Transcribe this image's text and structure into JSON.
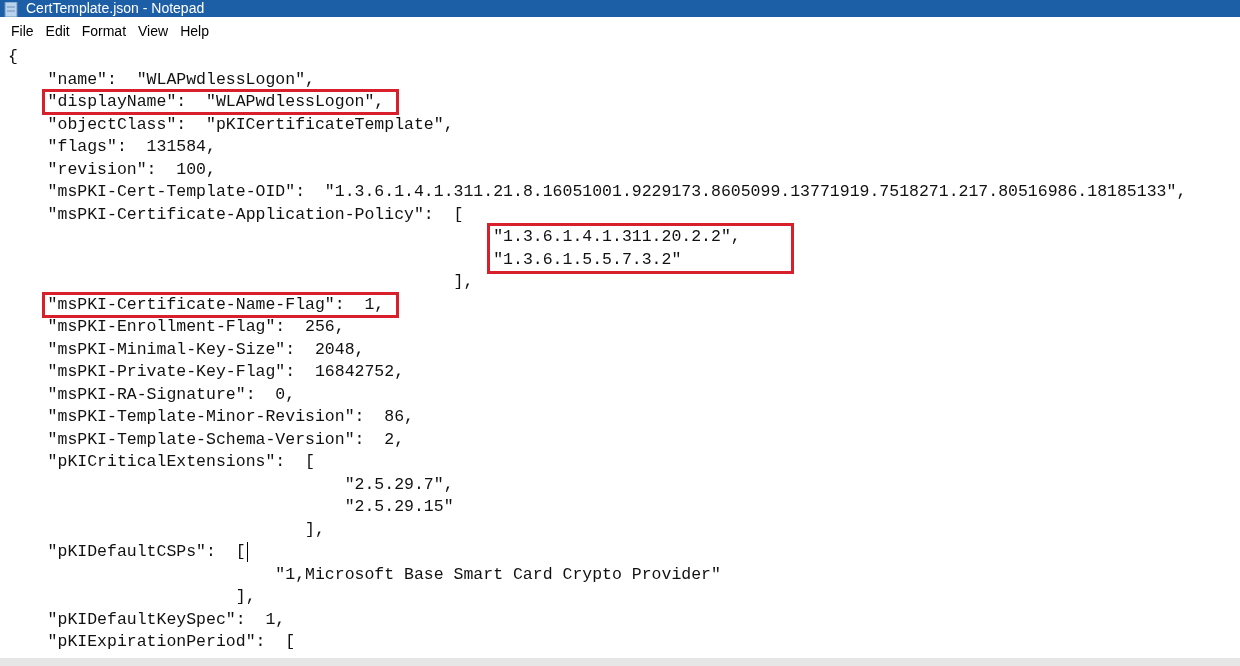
{
  "window": {
    "title": "CertTemplate.json - Notepad"
  },
  "menu": [
    "File",
    "Edit",
    "Format",
    "View",
    "Help"
  ],
  "document": {
    "open_brace": "{",
    "entries": [
      {
        "kind": "scalar",
        "key": "\"name\":",
        "value": "\"WLAPwdlessLogon\",",
        "highlighted": false,
        "text_cursor": false
      },
      {
        "kind": "scalar",
        "key": "\"displayName\":",
        "value": "\"WLAPwdlessLogon\",",
        "highlighted": true,
        "text_cursor": false
      },
      {
        "kind": "scalar",
        "key": "\"objectClass\":",
        "value": "\"pKICertificateTemplate\",",
        "highlighted": false,
        "text_cursor": false
      },
      {
        "kind": "scalar",
        "key": "\"flags\":",
        "value": "131584,",
        "highlighted": false,
        "text_cursor": false
      },
      {
        "kind": "scalar",
        "key": "\"revision\":",
        "value": "100,",
        "highlighted": false,
        "text_cursor": false
      },
      {
        "kind": "scalar",
        "key": "\"msPKI-Cert-Template-OID\":",
        "value": "\"1.3.6.1.4.1.311.21.8.16051001.9229173.8605099.13771919.7518271.217.80516986.18185133\",",
        "highlighted": false,
        "text_cursor": false
      },
      {
        "kind": "array",
        "key": "\"msPKI-Certificate-Application-Policy\":",
        "open": "[",
        "items": [
          "\"1.3.6.1.4.1.311.20.2.2\",",
          "\"1.3.6.1.5.5.7.3.2\""
        ],
        "close": "],",
        "highlighted": false,
        "items_highlighted": true,
        "text_cursor": false
      },
      {
        "kind": "scalar",
        "key": "\"msPKI-Certificate-Name-Flag\":",
        "value": "1,",
        "highlighted": true,
        "text_cursor": false
      },
      {
        "kind": "scalar",
        "key": "\"msPKI-Enrollment-Flag\":",
        "value": "256,",
        "highlighted": false,
        "text_cursor": false
      },
      {
        "kind": "scalar",
        "key": "\"msPKI-Minimal-Key-Size\":",
        "value": "2048,",
        "highlighted": false,
        "text_cursor": false
      },
      {
        "kind": "scalar",
        "key": "\"msPKI-Private-Key-Flag\":",
        "value": "16842752,",
        "highlighted": false,
        "text_cursor": false
      },
      {
        "kind": "scalar",
        "key": "\"msPKI-RA-Signature\":",
        "value": "0,",
        "highlighted": false,
        "text_cursor": false
      },
      {
        "kind": "scalar",
        "key": "\"msPKI-Template-Minor-Revision\":",
        "value": "86,",
        "highlighted": false,
        "text_cursor": false
      },
      {
        "kind": "scalar",
        "key": "\"msPKI-Template-Schema-Version\":",
        "value": "2,",
        "highlighted": false,
        "text_cursor": false
      },
      {
        "kind": "array",
        "key": "\"pKICriticalExtensions\":",
        "open": "[",
        "items": [
          "\"2.5.29.7\",",
          "\"2.5.29.15\""
        ],
        "close": "],",
        "highlighted": false,
        "items_highlighted": false,
        "text_cursor": false
      },
      {
        "kind": "array",
        "key": "\"pKIDefaultCSPs\":",
        "open": "[",
        "items": [
          "\"1,Microsoft Base Smart Card Crypto Provider\""
        ],
        "close": "],",
        "highlighted": false,
        "items_highlighted": false,
        "text_cursor": true
      },
      {
        "kind": "scalar",
        "key": "\"pKIDefaultKeySpec\":",
        "value": "1,",
        "highlighted": false,
        "text_cursor": false
      },
      {
        "kind": "array",
        "key": "\"pKIExpirationPeriod\":",
        "open": "[",
        "highlighted": false,
        "text_cursor": false
      }
    ]
  }
}
